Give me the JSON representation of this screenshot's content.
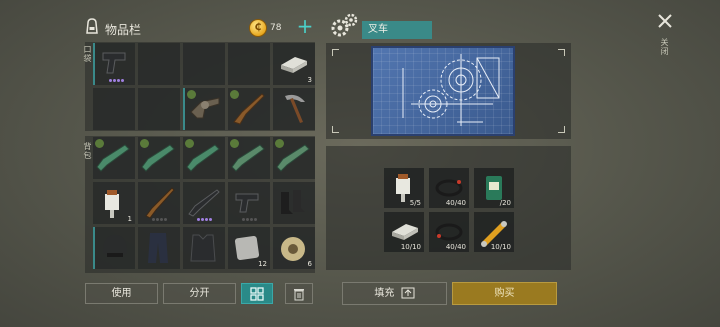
{
  "inventory": {
    "title": "物品栏",
    "coins": "78",
    "slots_label": "口袋",
    "backpack_label": "背包"
  },
  "pocket_items": [
    {
      "name": "pistol",
      "count": "",
      "dots": 4
    },
    {
      "name": "empty"
    },
    {
      "name": "empty"
    },
    {
      "name": "empty"
    },
    {
      "name": "metal-bar",
      "count": "3"
    },
    {
      "name": "empty"
    },
    {
      "name": "empty"
    },
    {
      "name": "revolver"
    },
    {
      "name": "shotgun"
    },
    {
      "name": "pickaxe"
    }
  ],
  "backpack_counts": {
    "spark_plug": "1",
    "square_plate": "12",
    "wire_spool": "6"
  },
  "buttons": {
    "use": "使用",
    "split": "分开",
    "fill": "填充",
    "buy": "购买"
  },
  "craft": {
    "name": "叉车",
    "close_label": "关闭"
  },
  "materials": [
    {
      "name": "spark-plug",
      "count": "5/5"
    },
    {
      "name": "wires",
      "count": "40/40"
    },
    {
      "name": "fuel-canister",
      "count": "/20"
    },
    {
      "name": "metal-bar",
      "count": "10/10"
    },
    {
      "name": "wires",
      "count": "40/40"
    },
    {
      "name": "hydraulic-cylinder",
      "count": "10/10"
    }
  ]
}
